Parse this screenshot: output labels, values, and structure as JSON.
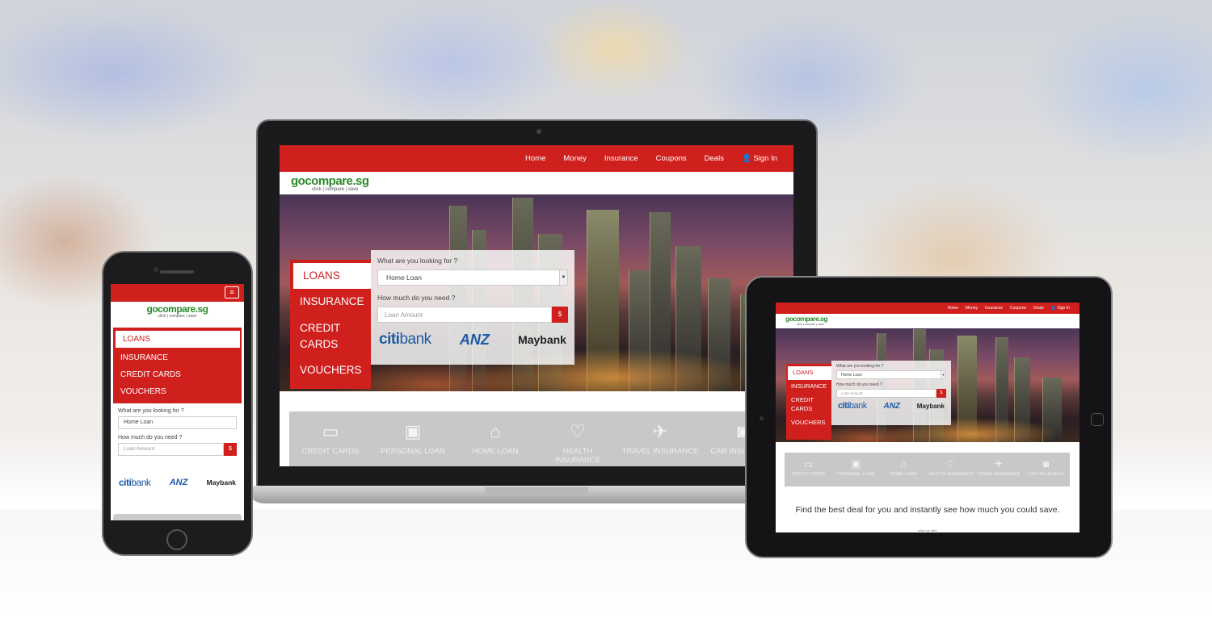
{
  "nav": {
    "home": "Home",
    "money": "Money",
    "insurance": "Insurance",
    "coupons": "Coupons",
    "deals": "Deals",
    "signin": "Sign In"
  },
  "brand": {
    "logo": "gocompare.sg",
    "tagline": "click | compare | save"
  },
  "menu": {
    "loans": "LOANS",
    "insurance": "INSURANCE",
    "credit_cards": "CREDIT CARDS",
    "vouchers": "VOUCHERS"
  },
  "form": {
    "q1": "What are you looking for ?",
    "selected": "Home Loan",
    "q2": "How much do you need ?",
    "placeholder": "Loan Amount",
    "currency": "$"
  },
  "banks": {
    "citi1": "citi",
    "citi2": "bank",
    "anz": "ANZ",
    "maybank": "Maybank"
  },
  "categories": [
    {
      "label": "CREDIT CARDS",
      "icon": "credit-card-icon",
      "glyph": "▭"
    },
    {
      "label": "PERSONAL LOAN",
      "icon": "money-icon",
      "glyph": "▣"
    },
    {
      "label": "HOME LOAN",
      "icon": "home-icon",
      "glyph": "⌂"
    },
    {
      "label": "HEALTH INSURANCE",
      "icon": "stethoscope-icon",
      "glyph": "♡"
    },
    {
      "label": "TRAVEL INSURANCE",
      "icon": "airplane-icon",
      "glyph": "✈"
    },
    {
      "label": "CAR INSURANCE",
      "icon": "car-icon",
      "glyph": "◙"
    }
  ],
  "deal_text": "Find the best deal for you and instantly see how much you could save.",
  "deal_small": "what we offer",
  "colors": {
    "accent": "#d0201e",
    "brand_green": "#2a8a2a"
  }
}
